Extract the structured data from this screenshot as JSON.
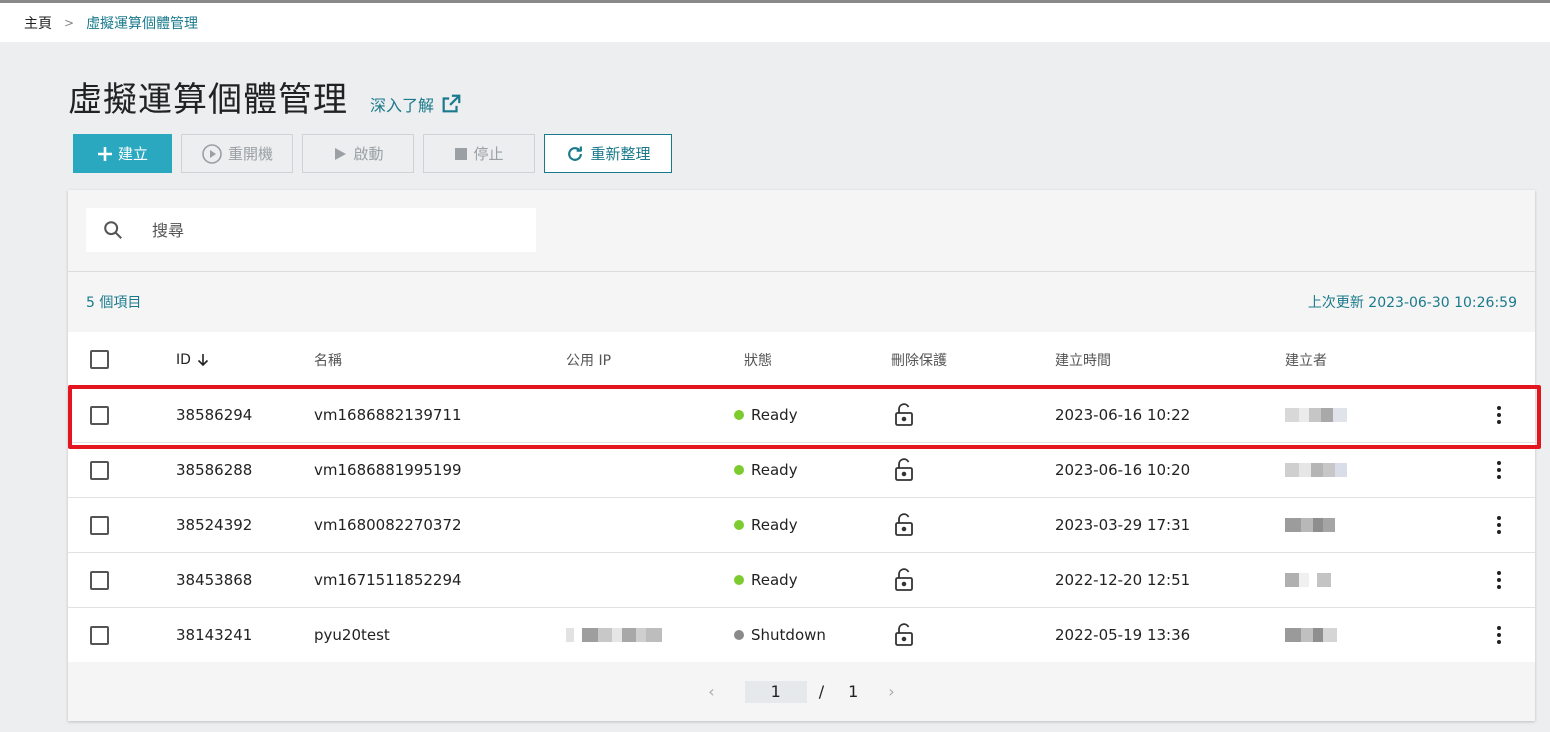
{
  "breadcrumb": {
    "home": "主頁",
    "separator": ">",
    "current": "虛擬運算個體管理"
  },
  "page": {
    "title": "虛擬運算個體管理",
    "learn_more": "深入了解"
  },
  "toolbar": {
    "create": "建立",
    "restart": "重開機",
    "start": "啟動",
    "stop": "停止",
    "refresh": "重新整理"
  },
  "search": {
    "placeholder": "搜尋"
  },
  "summary": {
    "count": "5 個項目",
    "last_update": "上次更新 2023-06-30 10:26:59"
  },
  "table": {
    "headers": {
      "id": "ID",
      "name": "名稱",
      "public_ip": "公用 IP",
      "status": "狀態",
      "delete_protection": "刪除保護",
      "created_time": "建立時間",
      "creator": "建立者"
    },
    "rows": [
      {
        "id": "38586294",
        "name": "vm1686882139711",
        "status": "Ready",
        "created": "2023-06-16 10:22"
      },
      {
        "id": "38586288",
        "name": "vm1686881995199",
        "status": "Ready",
        "created": "2023-06-16 10:20"
      },
      {
        "id": "38524392",
        "name": "vm1680082270372",
        "status": "Ready",
        "created": "2023-03-29 17:31"
      },
      {
        "id": "38453868",
        "name": "vm1671511852294",
        "status": "Ready",
        "created": "2022-12-20 12:51"
      },
      {
        "id": "38143241",
        "name": "pyu20test",
        "status": "Shutdown",
        "created": "2022-05-19 13:36"
      }
    ]
  },
  "pagination": {
    "current": "1",
    "separator": "/",
    "total": "1"
  },
  "colors": {
    "accent": "#2aa8bf",
    "link": "#1a7a8c",
    "ready": "#7ccc2f",
    "shutdown": "#8a8a8a",
    "highlight": "#e3161f"
  }
}
